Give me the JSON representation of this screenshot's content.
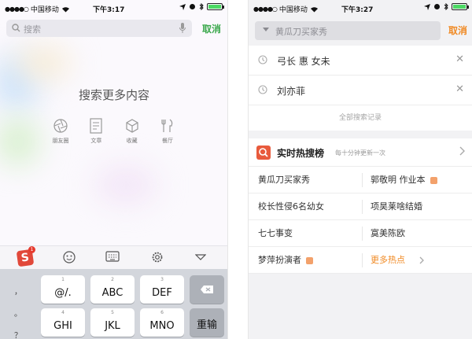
{
  "left_phone": {
    "status": {
      "carrier": "中国移动",
      "time": "下午3:17"
    },
    "search": {
      "placeholder": "搜索",
      "cancel_label": "取消"
    },
    "more_title": "搜索更多内容",
    "categories": [
      {
        "label": "朋友圈",
        "icon": "aperture-icon"
      },
      {
        "label": "文章",
        "icon": "article-icon"
      },
      {
        "label": "收藏",
        "icon": "cube-icon"
      },
      {
        "label": "餐厅",
        "icon": "dining-icon"
      }
    ],
    "toolbar_badge": "1",
    "keyboard": {
      "side_symbols": [
        "，",
        "。",
        "？"
      ],
      "keys": [
        {
          "num": "1",
          "label": "@/."
        },
        {
          "num": "2",
          "label": "ABC"
        },
        {
          "num": "3",
          "label": "DEF"
        },
        {
          "num": "4",
          "label": "GHI"
        },
        {
          "num": "5",
          "label": "JKL"
        },
        {
          "num": "6",
          "label": "MNO"
        }
      ],
      "return_label": "重输"
    }
  },
  "right_phone": {
    "status": {
      "carrier": "中国移动",
      "time": "下午3:27"
    },
    "search": {
      "query": "黄瓜刀买家秀",
      "cancel_label": "取消"
    },
    "history": [
      {
        "text": "弓长 惠 女未"
      },
      {
        "text": "刘亦菲"
      }
    ],
    "all_history_label": "全部搜索记录",
    "hot": {
      "title": "实时热搜榜",
      "subtitle": "每十分钟更新一次",
      "rows": [
        [
          "黄瓜刀买家秀",
          "郭敬明 作业本"
        ],
        [
          "校长性侵6名幼女",
          "项昊莱啥结婚"
        ],
        [
          "七七事变",
          "寞美陈欧"
        ],
        [
          "梦萍扮演者",
          "更多热点"
        ]
      ]
    }
  },
  "colors": {
    "left_accent": "#3aa84b",
    "right_accent": "#f08a24",
    "hot_icon": "#e85a3c",
    "tag": "#f3a16b"
  }
}
